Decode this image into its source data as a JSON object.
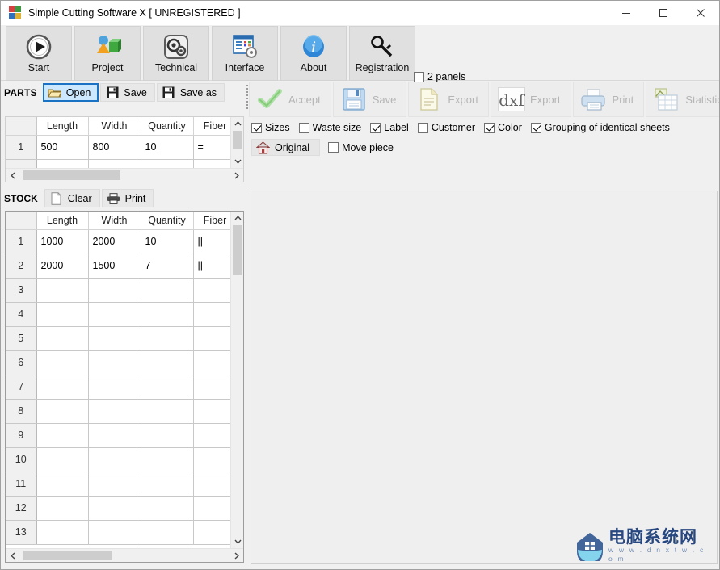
{
  "window": {
    "title": "Simple Cutting Software X [ UNREGISTERED ]",
    "icon": "app-logo-icon",
    "minimize_label": "—",
    "maximize_label": "☐",
    "close_label": "✕"
  },
  "ribbon": {
    "buttons": [
      {
        "label": "Start",
        "icon": "play-circle-icon"
      },
      {
        "label": "Project",
        "icon": "project-shapes-icon"
      },
      {
        "label": "Technical",
        "icon": "gears-icon"
      },
      {
        "label": "Interface",
        "icon": "window-settings-icon"
      },
      {
        "label": "About",
        "icon": "info-circle-icon"
      },
      {
        "label": "Registration",
        "icon": "key-icon"
      }
    ],
    "panels_checkbox": {
      "label": "2 panels",
      "checked": false
    }
  },
  "parts_panel": {
    "title": "PARTS",
    "buttons": [
      {
        "label": "Open",
        "icon": "open-folder-icon",
        "active": true
      },
      {
        "label": "Save",
        "icon": "floppy-disk-icon",
        "active": false
      },
      {
        "label": "Save as",
        "icon": "floppy-disk-icon",
        "active": false
      }
    ],
    "grid": {
      "columns": [
        "",
        "Length",
        "Width",
        "Quantity",
        "Fiber"
      ],
      "rows": [
        {
          "n": "1",
          "length": "500",
          "width": "800",
          "quantity": "10",
          "fiber": "="
        }
      ]
    }
  },
  "stock_panel": {
    "title": "STOCK",
    "buttons": [
      {
        "label": "Clear",
        "icon": "blank-page-icon"
      },
      {
        "label": "Print",
        "icon": "printer-icon"
      }
    ],
    "grid": {
      "columns": [
        "",
        "Length",
        "Width",
        "Quantity",
        "Fiber"
      ],
      "rows": [
        {
          "n": "1",
          "length": "1000",
          "width": "2000",
          "quantity": "10",
          "fiber": "||"
        },
        {
          "n": "2",
          "length": "2000",
          "width": "1500",
          "quantity": "7",
          "fiber": "||"
        },
        {
          "n": "3",
          "length": "",
          "width": "",
          "quantity": "",
          "fiber": ""
        },
        {
          "n": "4",
          "length": "",
          "width": "",
          "quantity": "",
          "fiber": ""
        },
        {
          "n": "5",
          "length": "",
          "width": "",
          "quantity": "",
          "fiber": ""
        },
        {
          "n": "6",
          "length": "",
          "width": "",
          "quantity": "",
          "fiber": ""
        },
        {
          "n": "7",
          "length": "",
          "width": "",
          "quantity": "",
          "fiber": ""
        },
        {
          "n": "8",
          "length": "",
          "width": "",
          "quantity": "",
          "fiber": ""
        },
        {
          "n": "9",
          "length": "",
          "width": "",
          "quantity": "",
          "fiber": ""
        },
        {
          "n": "10",
          "length": "",
          "width": "",
          "quantity": "",
          "fiber": ""
        },
        {
          "n": "11",
          "length": "",
          "width": "",
          "quantity": "",
          "fiber": ""
        },
        {
          "n": "12",
          "length": "",
          "width": "",
          "quantity": "",
          "fiber": ""
        },
        {
          "n": "13",
          "length": "",
          "width": "",
          "quantity": "",
          "fiber": ""
        }
      ]
    }
  },
  "result_toolbar": {
    "buttons": [
      {
        "label": "Accept",
        "icon": "green-check-icon",
        "disabled": true
      },
      {
        "label": "Save",
        "icon": "floppy-disk-icon",
        "disabled": true
      },
      {
        "label": "Export",
        "icon": "document-export-icon",
        "disabled": true
      },
      {
        "label": "Export",
        "icon": "dxf-icon",
        "disabled": true
      },
      {
        "label": "Print",
        "icon": "printer-icon",
        "disabled": true
      },
      {
        "label": "Statistics",
        "icon": "statistics-table-icon",
        "disabled": true
      }
    ],
    "options": [
      {
        "label": "Sizes",
        "checked": true
      },
      {
        "label": "Waste size",
        "checked": false
      },
      {
        "label": "Label",
        "checked": true
      },
      {
        "label": "Customer",
        "checked": false
      },
      {
        "label": "Color",
        "checked": true
      },
      {
        "label": "Grouping of identical sheets",
        "checked": true
      }
    ],
    "original_button": {
      "label": "Original",
      "icon": "home-icon"
    },
    "move_piece": {
      "label": "Move piece",
      "checked": false
    }
  },
  "watermark": {
    "cn_text": "电脑系统网",
    "url_text": "w w w . d n x t w . c o m"
  },
  "colors": {
    "accent_blue": "#1a72c4",
    "active_tab_fill": "#cce8ff",
    "window_bg": "#f0f0f0",
    "grid_bg": "#ffffff"
  }
}
